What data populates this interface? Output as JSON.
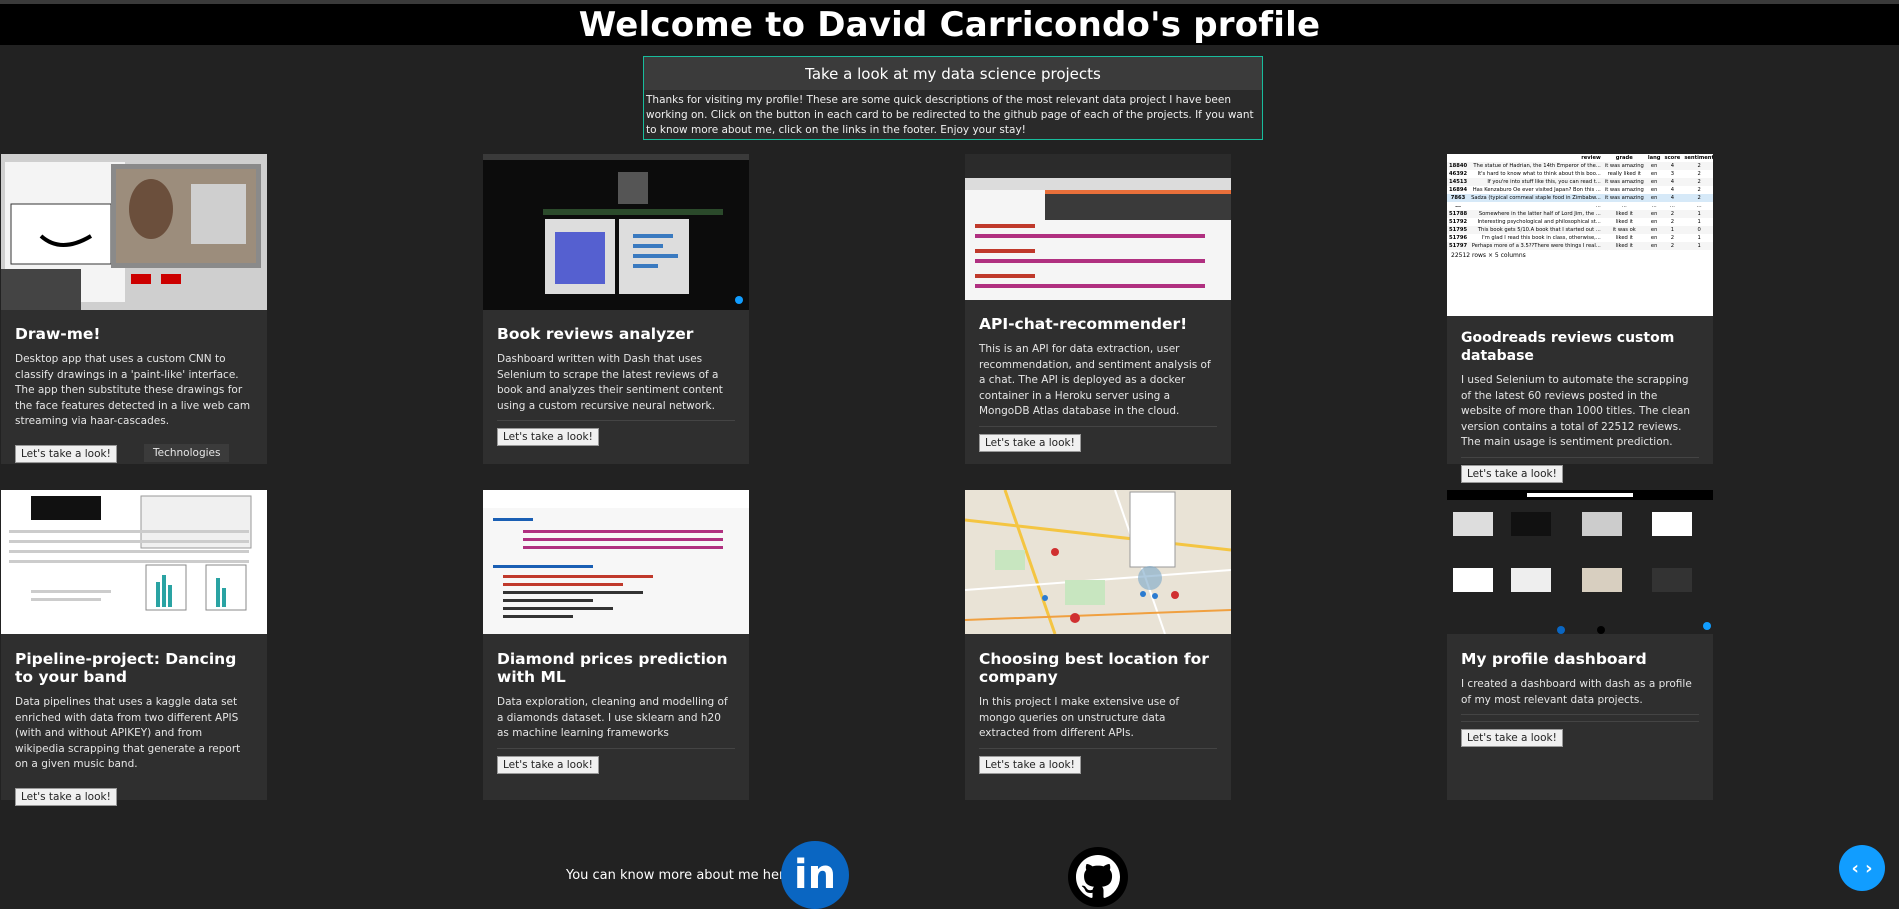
{
  "header": {
    "title": "Welcome to David Carricondo's profile"
  },
  "intro": {
    "title": "Take a look at my data science projects",
    "body": "Thanks for visiting my profile! These are some quick descriptions of the most relevant data project I have been working on. Click on the button in each card to be redirected to the github page of each of the projects. If you want to know more about me, click on the links in the footer. Enjoy your stay!"
  },
  "cards": [
    {
      "title": "Draw-me!",
      "description": "Desktop app that uses a custom CNN to classify drawings in a 'paint-like' interface. The app then substitute these drawings for the face features detected in a live web cam streaming via haar-cascades.",
      "button": "Let's take a look!",
      "extra_button": "Technologies"
    },
    {
      "title": "Book reviews analyzer",
      "description": "Dashboard written with Dash that uses Selenium to scrape the latest reviews of a book and analyzes their sentiment content using a custom recursive neural network.",
      "button": "Let's take a look!"
    },
    {
      "title": "API-chat-recommender!",
      "description": "This is an API for data extraction, user recommendation, and sentiment analysis of a chat. The API is deployed as a docker container in a Heroku server using a MongoDB Atlas database in the cloud.",
      "button": "Let's take a look!"
    },
    {
      "title": "Goodreads reviews custom database",
      "description": "I used Selenium to automate the scrapping of the latest 60 reviews posted in the website of more than 1000 titles. The clean version contains a total of 22512 reviews. The main usage is sentiment prediction.",
      "button": "Let's take a look!"
    },
    {
      "title": "Pipeline-project: Dancing to your band",
      "description": "Data pipelines that uses a kaggle data set enriched with data from two different APIS (with and without APIKEY) and from wikipedia scrapping that generate a report on a given music band.",
      "button": "Let's take a look!"
    },
    {
      "title": "Diamond prices prediction with ML",
      "description": "Data exploration, cleaning and modelling of a diamonds dataset. I use sklearn and h20 as machine learning frameworks",
      "button": "Let's take a look!"
    },
    {
      "title": "Choosing best location for company",
      "description": "In this project I make extensive use of mongo queries on unstructure data extracted from different APIs.",
      "button": "Let's take a look!"
    },
    {
      "title": "My profile dashboard",
      "description": "I created a dashboard with dash as a profile of my most relevant data projects.",
      "button": "Let's take a look!"
    }
  ],
  "goodreads_table": {
    "headers": [
      "review",
      "grade",
      "lang",
      "score",
      "sentiment"
    ],
    "rows": [
      [
        "18840",
        "The statue of Hadrian, the 14th Emperor of the...",
        "it was amazing",
        "en",
        "4",
        "2"
      ],
      [
        "46392",
        "It's hard to know what to think about this boo...",
        "really liked it",
        "en",
        "3",
        "2"
      ],
      [
        "14513",
        "If you're into stuff like this, you can read t...",
        "it was amazing",
        "en",
        "4",
        "2"
      ],
      [
        "16894",
        "Has Kenzaburo Oe ever visited Japan? Bon this ...",
        "it was amazing",
        "en",
        "4",
        "2"
      ],
      [
        "7863",
        "Sadza (typical cornmeal staple food in Zimbabw...",
        "it was amazing",
        "en",
        "4",
        "2"
      ],
      [
        "...",
        "...",
        "...",
        "...",
        "...",
        "..."
      ],
      [
        "51788",
        "Somewhere in the latter half of Lord Jim, the ...",
        "liked it",
        "en",
        "2",
        "1"
      ],
      [
        "51792",
        "Interesting psychological and philosophical st...",
        "liked it",
        "en",
        "2",
        "1"
      ],
      [
        "51795",
        "This book gets 5/10.A book that I started out ...",
        "it was ok",
        "en",
        "1",
        "0"
      ],
      [
        "51796",
        "I'm glad I read this book in class, otherwise,...",
        "liked it",
        "en",
        "2",
        "1"
      ],
      [
        "51797",
        "Perhaps more of a 3.5??There were things I real...",
        "liked it",
        "en",
        "2",
        "1"
      ]
    ],
    "caption": "22512 rows × 5 columns"
  },
  "footer": {
    "text": "You can know more about me here:",
    "linkedin_label": "in"
  },
  "icons": [
    "linkedin-icon",
    "github-icon",
    "code-icon"
  ],
  "colors": {
    "accent": "#18bc9c",
    "linkedin": "#0a66c2",
    "fab": "#119dff"
  }
}
